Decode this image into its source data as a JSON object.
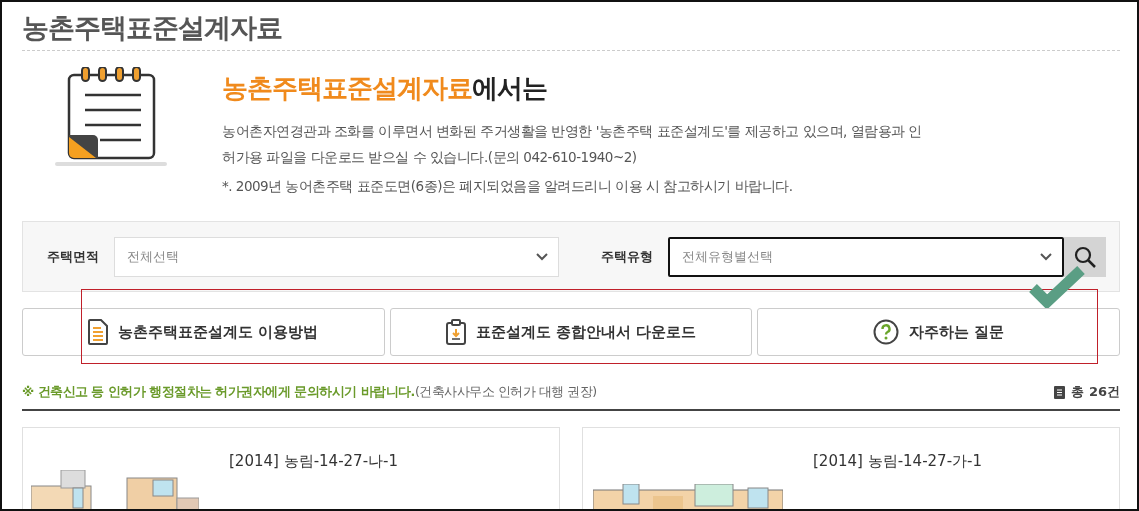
{
  "page_title": "농촌주택표준설계자료",
  "intro": {
    "heading_highlight": "농촌주택표준설계자료",
    "heading_rest": "에서는",
    "description": "농어촌자연경관과 조화를 이루면서 변화된 주거생활을 반영한 '농촌주택 표준설계도'를 제공하고 있으며, 열람용과 인허가용 파일을 다운로드 받으실 수 있습니다.(문의 042-610-1940~2)",
    "note": "*. 2009년 농어촌주택 표준도면(6종)은 폐지되었음을 알려드리니 이용 시 참고하시기 바랍니다."
  },
  "filters": [
    {
      "label": "주택면적",
      "placeholder": "전체선택",
      "focused": false
    },
    {
      "label": "주택유형",
      "placeholder": "전체유형별선택",
      "focused": true
    }
  ],
  "buttons": [
    {
      "label": "농촌주택표준설계도 이용방법",
      "kind": "document"
    },
    {
      "label": "표준설계도 종합안내서 다운로드",
      "kind": "clipboard"
    },
    {
      "label": "자주하는 질문",
      "kind": "question"
    }
  ],
  "notice": {
    "text": "※ 건축신고 등 인허가 행정절차는 허가권자에게 문의하시기 바랍니다.",
    "aside": "(건축사사무소 인허가 대행 권장)",
    "total": "총 26건"
  },
  "cards": [
    {
      "title": "[2014] 농림-14-27-나-1",
      "kind": "picture"
    },
    {
      "title": "[2014] 농림-14-27-가-1",
      "kind": "picture"
    }
  ]
}
